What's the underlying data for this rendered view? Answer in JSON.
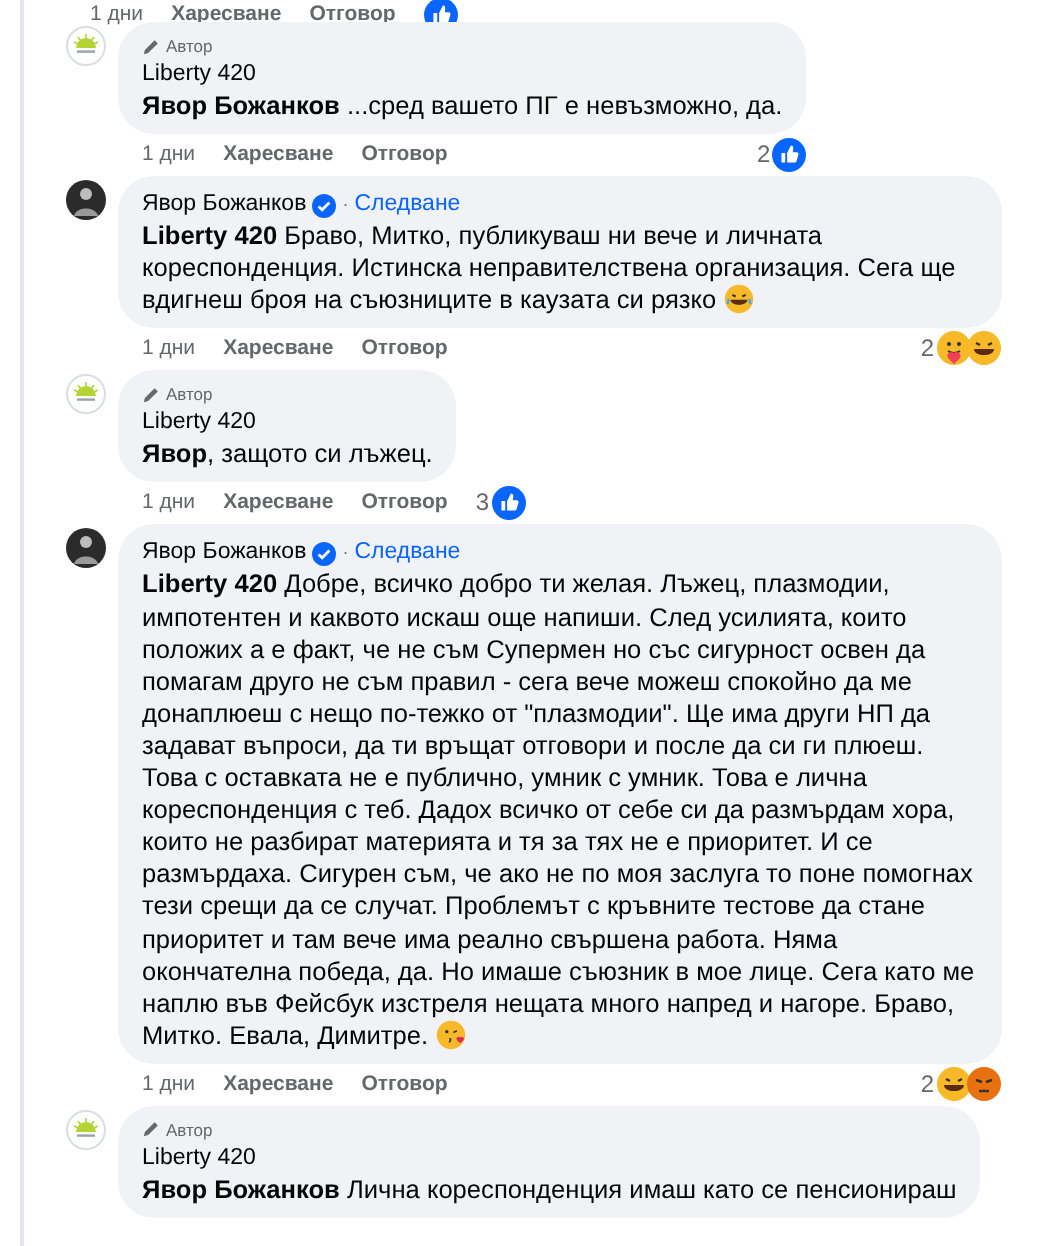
{
  "top_actions": {
    "time": "1 дни",
    "like": "Харесване",
    "reply": "Отговор",
    "reactions": [
      {
        "kind": "like"
      }
    ]
  },
  "comments": [
    {
      "avatar": {
        "kind": "logo"
      },
      "author_badge": "Автор",
      "author": "Liberty 420",
      "verified": false,
      "text": "**Явор Божанков** ...сред вашето ПГ е невъзможно, да.",
      "time": "1 дни",
      "like": "Харесване",
      "reply": "Отговор",
      "reaction_count": "2",
      "reactions": [
        {
          "kind": "like"
        }
      ]
    },
    {
      "avatar": {
        "kind": "photo"
      },
      "author": "Явор Божанков",
      "verified": true,
      "separator": "·",
      "follow": "Следване",
      "text": "**Liberty 420** Браво, Митко, публикуваш ни вече и личната кореспонденция. Истинска неправителствена организация. Сега ще вдигнеш броя на съюзниците в каузата си рязко",
      "emoji": {
        "kind": "laugh"
      },
      "time": "1 дни",
      "like": "Харесване",
      "reply": "Отговор",
      "reaction_count": "2",
      "reactions": [
        {
          "kind": "care"
        },
        {
          "kind": "haha"
        }
      ]
    },
    {
      "avatar": {
        "kind": "logo"
      },
      "author_badge": "Автор",
      "author": "Liberty 420",
      "verified": false,
      "text": "**Явор**, защото си лъжец.",
      "time": "1 дни",
      "like": "Харесване",
      "reply": "Отговор",
      "reaction_count": "3",
      "reactions": [
        {
          "kind": "like"
        }
      ]
    },
    {
      "avatar": {
        "kind": "photo"
      },
      "author": "Явор Божанков",
      "verified": true,
      "separator": "·",
      "follow": "Следване",
      "text": "**Liberty 420** Добре, всичко добро ти желая. Лъжец, плазмодии, импотентен и каквото искаш още напиши. След усилията, които положих а е факт, че не съм Супермен но със сигурност освен да помагам друго не съм правил - сега вече можеш спокойно да ме донаплюеш с нещо по-тежко от \"плазмодии\". Ще има други НП да задават въпроси, да ти връщат отговори и после да си ги плюеш. Това с оставката не е публично, умник с умник. Това е лична кореспонденция с теб. Дадох всичко от себе си да размърдам хора, които не разбират материята и тя за тях не е приоритет. И се размърдаха. Сигурен съм, че ако не по моя заслуга то поне помогнах тези срещи да се случат. Проблемът с кръвните тестове да стане приоритет и там вече има реално свършена работа. Няма окончателна победа, да. Но имаше съюзник в мое лице. Сега като ме наплю във Фейсбук изстреля нещата много напред и нагоре. Браво, Митко. Евала, Димитре.",
      "emoji": {
        "kind": "kiss"
      },
      "time": "1 дни",
      "like": "Харесване",
      "reply": "Отговор",
      "reaction_count": "2",
      "reactions": [
        {
          "kind": "haha"
        },
        {
          "kind": "angry"
        }
      ]
    },
    {
      "avatar": {
        "kind": "logo"
      },
      "author_badge": "Автор",
      "author": "Liberty 420",
      "verified": false,
      "text": "**Явор Божанков** Лична кореспонденция имаш като се пенсионираш"
    }
  ]
}
